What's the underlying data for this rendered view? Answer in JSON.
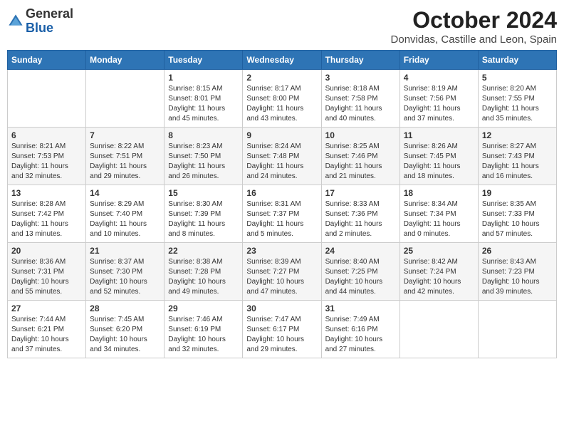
{
  "logo": {
    "general": "General",
    "blue": "Blue"
  },
  "header": {
    "month": "October 2024",
    "subtitle": "Donvidas, Castille and Leon, Spain"
  },
  "weekdays": [
    "Sunday",
    "Monday",
    "Tuesday",
    "Wednesday",
    "Thursday",
    "Friday",
    "Saturday"
  ],
  "weeks": [
    [
      {
        "day": null,
        "sunrise": null,
        "sunset": null,
        "daylight": null
      },
      {
        "day": null,
        "sunrise": null,
        "sunset": null,
        "daylight": null
      },
      {
        "day": 1,
        "sunrise": "Sunrise: 8:15 AM",
        "sunset": "Sunset: 8:01 PM",
        "daylight": "Daylight: 11 hours and 45 minutes."
      },
      {
        "day": 2,
        "sunrise": "Sunrise: 8:17 AM",
        "sunset": "Sunset: 8:00 PM",
        "daylight": "Daylight: 11 hours and 43 minutes."
      },
      {
        "day": 3,
        "sunrise": "Sunrise: 8:18 AM",
        "sunset": "Sunset: 7:58 PM",
        "daylight": "Daylight: 11 hours and 40 minutes."
      },
      {
        "day": 4,
        "sunrise": "Sunrise: 8:19 AM",
        "sunset": "Sunset: 7:56 PM",
        "daylight": "Daylight: 11 hours and 37 minutes."
      },
      {
        "day": 5,
        "sunrise": "Sunrise: 8:20 AM",
        "sunset": "Sunset: 7:55 PM",
        "daylight": "Daylight: 11 hours and 35 minutes."
      }
    ],
    [
      {
        "day": 6,
        "sunrise": "Sunrise: 8:21 AM",
        "sunset": "Sunset: 7:53 PM",
        "daylight": "Daylight: 11 hours and 32 minutes."
      },
      {
        "day": 7,
        "sunrise": "Sunrise: 8:22 AM",
        "sunset": "Sunset: 7:51 PM",
        "daylight": "Daylight: 11 hours and 29 minutes."
      },
      {
        "day": 8,
        "sunrise": "Sunrise: 8:23 AM",
        "sunset": "Sunset: 7:50 PM",
        "daylight": "Daylight: 11 hours and 26 minutes."
      },
      {
        "day": 9,
        "sunrise": "Sunrise: 8:24 AM",
        "sunset": "Sunset: 7:48 PM",
        "daylight": "Daylight: 11 hours and 24 minutes."
      },
      {
        "day": 10,
        "sunrise": "Sunrise: 8:25 AM",
        "sunset": "Sunset: 7:46 PM",
        "daylight": "Daylight: 11 hours and 21 minutes."
      },
      {
        "day": 11,
        "sunrise": "Sunrise: 8:26 AM",
        "sunset": "Sunset: 7:45 PM",
        "daylight": "Daylight: 11 hours and 18 minutes."
      },
      {
        "day": 12,
        "sunrise": "Sunrise: 8:27 AM",
        "sunset": "Sunset: 7:43 PM",
        "daylight": "Daylight: 11 hours and 16 minutes."
      }
    ],
    [
      {
        "day": 13,
        "sunrise": "Sunrise: 8:28 AM",
        "sunset": "Sunset: 7:42 PM",
        "daylight": "Daylight: 11 hours and 13 minutes."
      },
      {
        "day": 14,
        "sunrise": "Sunrise: 8:29 AM",
        "sunset": "Sunset: 7:40 PM",
        "daylight": "Daylight: 11 hours and 10 minutes."
      },
      {
        "day": 15,
        "sunrise": "Sunrise: 8:30 AM",
        "sunset": "Sunset: 7:39 PM",
        "daylight": "Daylight: 11 hours and 8 minutes."
      },
      {
        "day": 16,
        "sunrise": "Sunrise: 8:31 AM",
        "sunset": "Sunset: 7:37 PM",
        "daylight": "Daylight: 11 hours and 5 minutes."
      },
      {
        "day": 17,
        "sunrise": "Sunrise: 8:33 AM",
        "sunset": "Sunset: 7:36 PM",
        "daylight": "Daylight: 11 hours and 2 minutes."
      },
      {
        "day": 18,
        "sunrise": "Sunrise: 8:34 AM",
        "sunset": "Sunset: 7:34 PM",
        "daylight": "Daylight: 11 hours and 0 minutes."
      },
      {
        "day": 19,
        "sunrise": "Sunrise: 8:35 AM",
        "sunset": "Sunset: 7:33 PM",
        "daylight": "Daylight: 10 hours and 57 minutes."
      }
    ],
    [
      {
        "day": 20,
        "sunrise": "Sunrise: 8:36 AM",
        "sunset": "Sunset: 7:31 PM",
        "daylight": "Daylight: 10 hours and 55 minutes."
      },
      {
        "day": 21,
        "sunrise": "Sunrise: 8:37 AM",
        "sunset": "Sunset: 7:30 PM",
        "daylight": "Daylight: 10 hours and 52 minutes."
      },
      {
        "day": 22,
        "sunrise": "Sunrise: 8:38 AM",
        "sunset": "Sunset: 7:28 PM",
        "daylight": "Daylight: 10 hours and 49 minutes."
      },
      {
        "day": 23,
        "sunrise": "Sunrise: 8:39 AM",
        "sunset": "Sunset: 7:27 PM",
        "daylight": "Daylight: 10 hours and 47 minutes."
      },
      {
        "day": 24,
        "sunrise": "Sunrise: 8:40 AM",
        "sunset": "Sunset: 7:25 PM",
        "daylight": "Daylight: 10 hours and 44 minutes."
      },
      {
        "day": 25,
        "sunrise": "Sunrise: 8:42 AM",
        "sunset": "Sunset: 7:24 PM",
        "daylight": "Daylight: 10 hours and 42 minutes."
      },
      {
        "day": 26,
        "sunrise": "Sunrise: 8:43 AM",
        "sunset": "Sunset: 7:23 PM",
        "daylight": "Daylight: 10 hours and 39 minutes."
      }
    ],
    [
      {
        "day": 27,
        "sunrise": "Sunrise: 7:44 AM",
        "sunset": "Sunset: 6:21 PM",
        "daylight": "Daylight: 10 hours and 37 minutes."
      },
      {
        "day": 28,
        "sunrise": "Sunrise: 7:45 AM",
        "sunset": "Sunset: 6:20 PM",
        "daylight": "Daylight: 10 hours and 34 minutes."
      },
      {
        "day": 29,
        "sunrise": "Sunrise: 7:46 AM",
        "sunset": "Sunset: 6:19 PM",
        "daylight": "Daylight: 10 hours and 32 minutes."
      },
      {
        "day": 30,
        "sunrise": "Sunrise: 7:47 AM",
        "sunset": "Sunset: 6:17 PM",
        "daylight": "Daylight: 10 hours and 29 minutes."
      },
      {
        "day": 31,
        "sunrise": "Sunrise: 7:49 AM",
        "sunset": "Sunset: 6:16 PM",
        "daylight": "Daylight: 10 hours and 27 minutes."
      },
      {
        "day": null,
        "sunrise": null,
        "sunset": null,
        "daylight": null
      },
      {
        "day": null,
        "sunrise": null,
        "sunset": null,
        "daylight": null
      }
    ]
  ]
}
